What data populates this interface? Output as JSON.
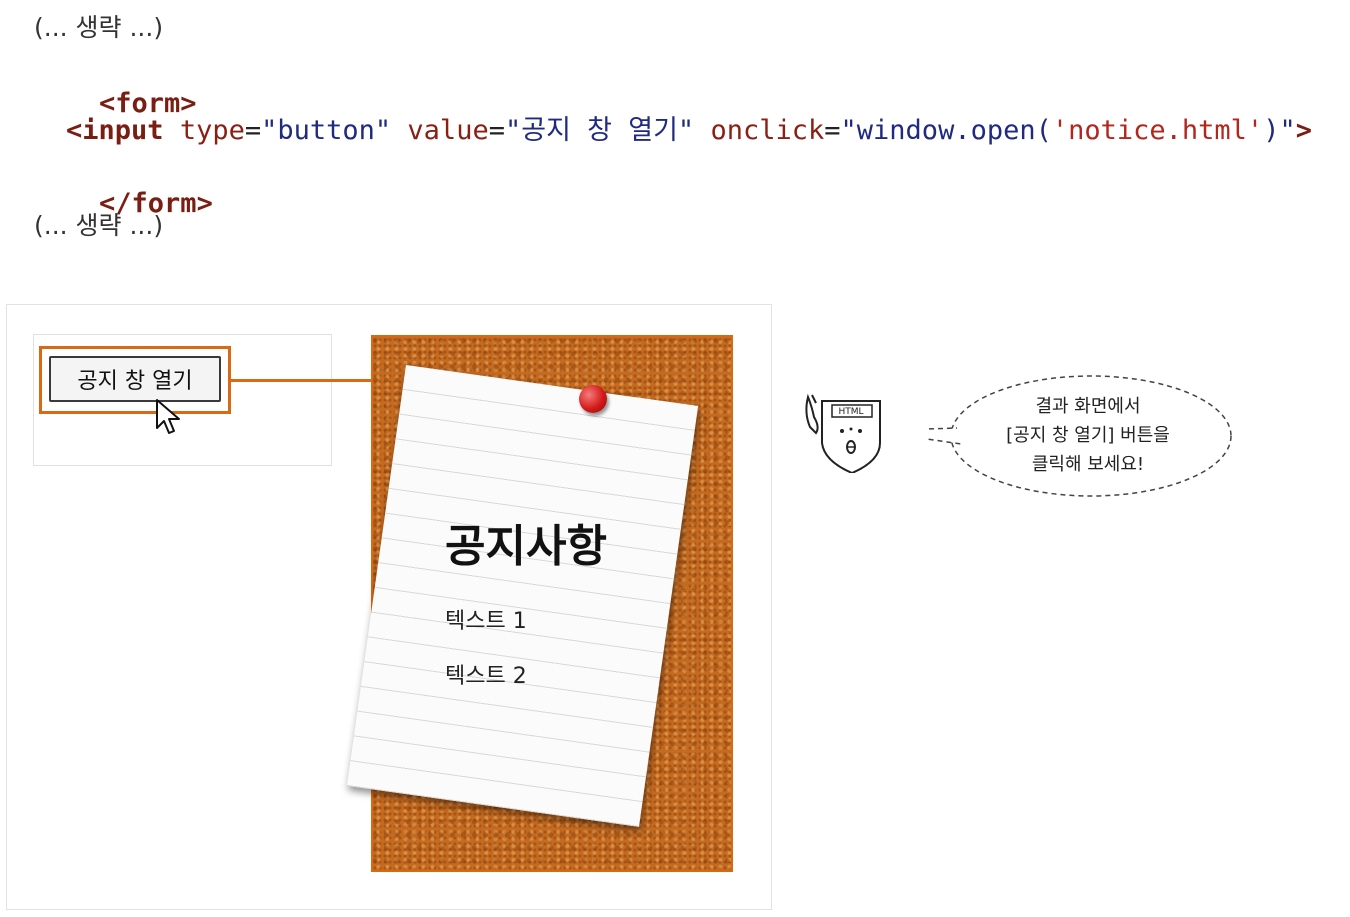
{
  "code": {
    "ellipsis_top": "(... 생략 ...)",
    "form_open": "<form>",
    "input_tag_open": "<input",
    "attr_type": "type",
    "type_value": "\"button\"",
    "attr_value": "value",
    "value_value": "\"공지 창 열기\"",
    "attr_onclick": "onclick",
    "onclick_pre": "\"window.open(",
    "onclick_str": "'notice.html'",
    "onclick_post": ")\"",
    "input_close": ">",
    "form_close": "</form>",
    "ellipsis_bottom": "(... 생략 ...)"
  },
  "result": {
    "button_label": "공지 창 열기",
    "notice_title": "공지사항",
    "notice_texts": [
      "텍스트 1",
      "텍스트 2"
    ]
  },
  "callout": {
    "mascot_label": "HTML",
    "lines": [
      "결과 화면에서",
      "[공지 창 열기] 버튼을",
      "클릭해 보세요!"
    ]
  },
  "colors": {
    "accent": "#d96a13",
    "tag": "#7a1e14",
    "attribute": "#8a1f14",
    "value": "#1f2a80",
    "string": "#b3261e",
    "cork": "#c56a1f",
    "pin": "#d41a1a"
  }
}
